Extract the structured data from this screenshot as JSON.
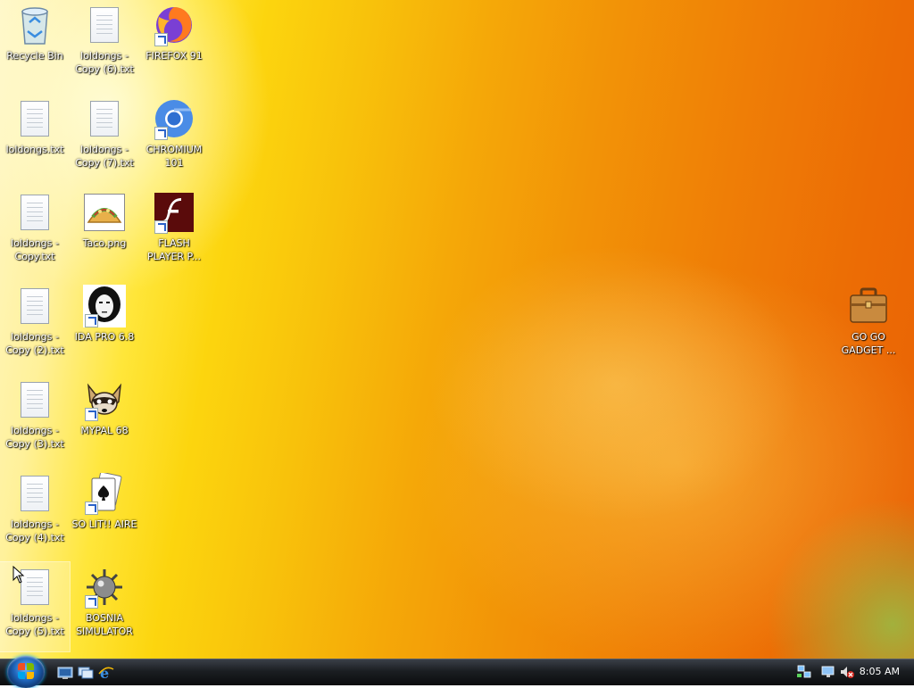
{
  "desktop": {
    "icons": [
      {
        "label": "Recycle Bin",
        "icon": "recycle-bin-icon"
      },
      {
        "label": "loldongs.txt",
        "icon": "text-file-icon"
      },
      {
        "label": "loldongs - Copy.txt",
        "icon": "text-file-icon"
      },
      {
        "label": "loldongs - Copy (2).txt",
        "icon": "text-file-icon"
      },
      {
        "label": "loldongs - Copy (3).txt",
        "icon": "text-file-icon"
      },
      {
        "label": "loldongs - Copy (4).txt",
        "icon": "text-file-icon"
      },
      {
        "label": "loldongs - Copy (5).txt",
        "icon": "text-file-icon"
      },
      {
        "label": "loldongs - Copy (6).txt",
        "icon": "text-file-icon"
      },
      {
        "label": "loldongs - Copy (7).txt",
        "icon": "text-file-icon"
      },
      {
        "label": "Taco.png",
        "icon": "taco-image-icon"
      },
      {
        "label": "IDA PRO 6.8",
        "icon": "ida-pro-icon"
      },
      {
        "label": "MYPAL 68",
        "icon": "raccoon-icon"
      },
      {
        "label": "SO LIT!! AIRE",
        "icon": "solitaire-cards-icon"
      },
      {
        "label": "BOSNIA SIMULATOR",
        "icon": "mine-icon"
      },
      {
        "label": "FIREFOX 91",
        "icon": "firefox-icon"
      },
      {
        "label": "CHROMIUM 101",
        "icon": "chromium-icon"
      },
      {
        "label": "FLASH PLAYER P...",
        "icon": "flash-player-icon"
      },
      {
        "label": "GO GO GADGET ...",
        "icon": "briefcase-icon"
      }
    ]
  },
  "taskbar": {
    "start_button": "start-orb-icon",
    "quick_launch": [
      "show-desktop-icon",
      "switch-windows-icon",
      "internet-explorer-icon"
    ],
    "tray": [
      "network-icon",
      "display-icon",
      "volume-muted-icon"
    ],
    "clock": "8:05 AM"
  },
  "colors": {
    "wallpaper_left": "#fff7c8",
    "wallpaper_mid": "#f5a808",
    "wallpaper_right": "#e96205",
    "taskbar": "#1b1e22"
  }
}
